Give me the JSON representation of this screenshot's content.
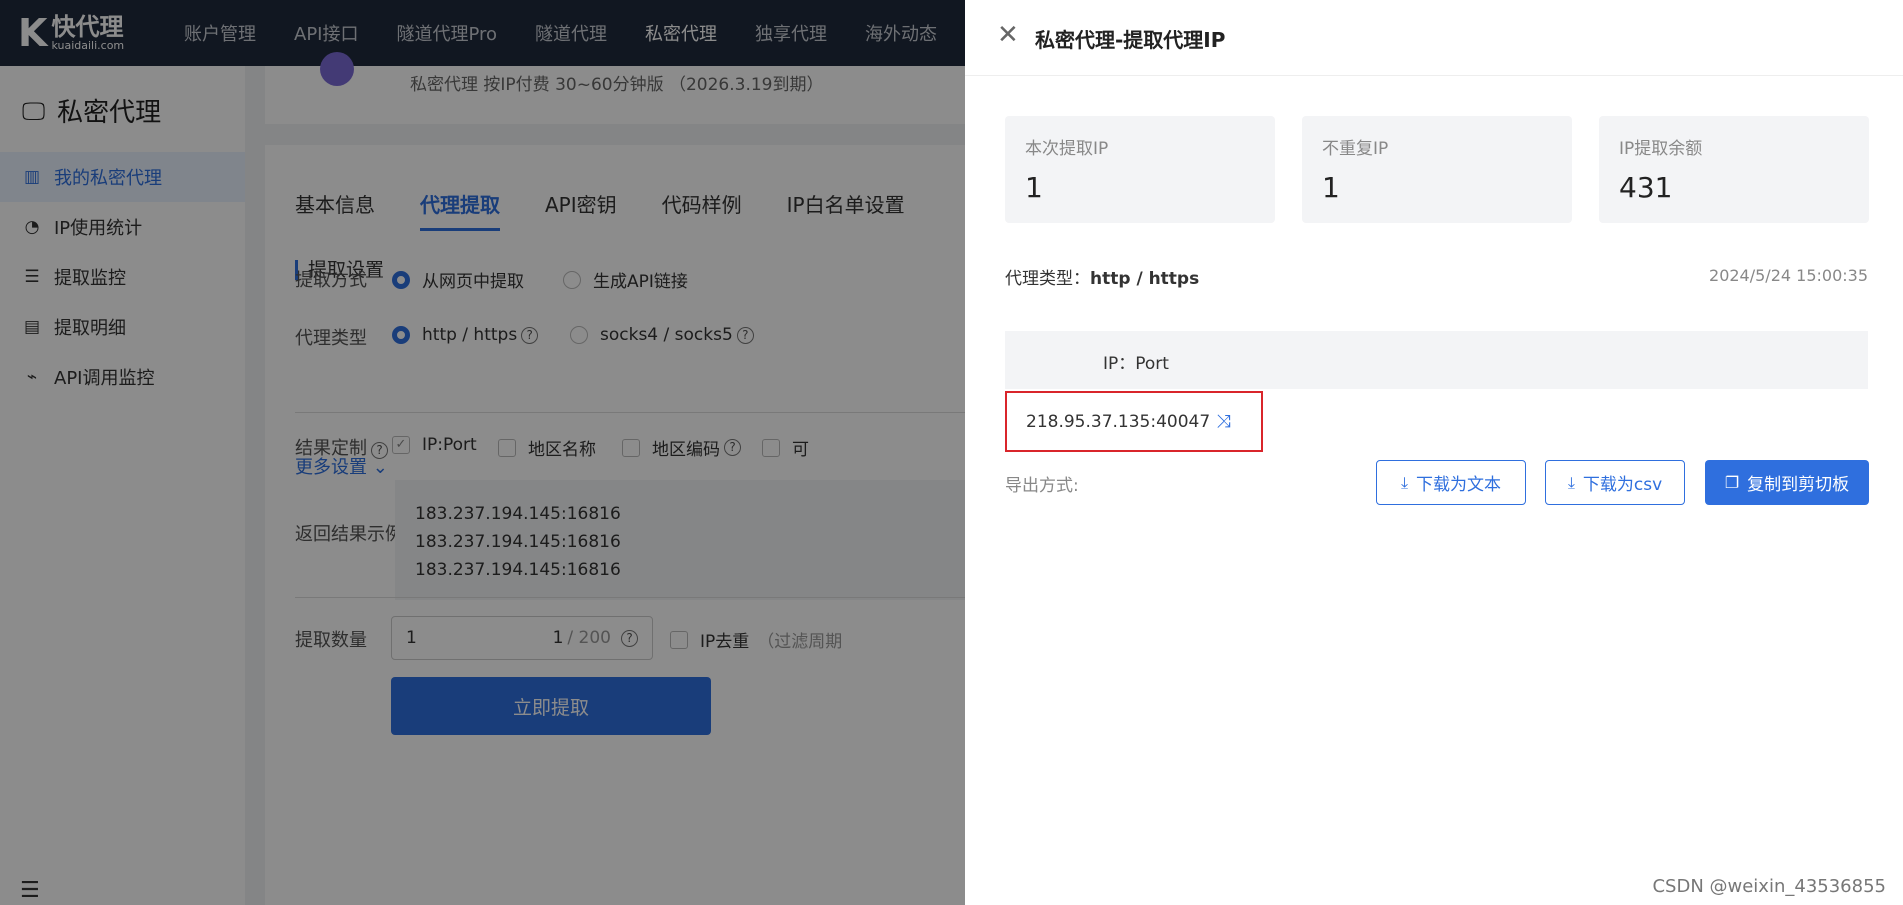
{
  "logo": {
    "mark": "K",
    "name": "快代理",
    "domain": "kuaidaili.com"
  },
  "topnav": [
    {
      "label": "账户管理"
    },
    {
      "label": "API接口"
    },
    {
      "label": "隧道代理Pro"
    },
    {
      "label": "隧道代理"
    },
    {
      "label": "私密代理",
      "active": true
    },
    {
      "label": "独享代理"
    },
    {
      "label": "海外动态"
    }
  ],
  "sidebar": {
    "title": "私密代理",
    "items": [
      {
        "label": "我的私密代理",
        "icon": "bar-chart-icon",
        "active": true
      },
      {
        "label": "IP使用统计",
        "icon": "pie-chart-icon"
      },
      {
        "label": "提取监控",
        "icon": "filter-icon"
      },
      {
        "label": "提取明细",
        "icon": "list-icon"
      },
      {
        "label": "API调用监控",
        "icon": "plug-icon"
      }
    ]
  },
  "main": {
    "subtitle": "私密代理  按IP付费  30~60分钟版  （2026.3.19到期）",
    "tabs": [
      "基本信息",
      "代理提取",
      "API密钥",
      "代码样例",
      "IP白名单设置"
    ],
    "active_tab": "代理提取",
    "section_title": "提取设置",
    "extract_method_label": "提取方式",
    "extract_methods": [
      "从网页中提取",
      "生成API链接"
    ],
    "proxy_type_label": "代理类型",
    "proxy_types": [
      "http / https",
      "socks4 / socks5"
    ],
    "more_settings": "更多设置",
    "result_label": "结果定制",
    "result_options": [
      "IP:Port",
      "地区名称",
      "地区编码",
      "可"
    ],
    "example_label": "返回结果示例",
    "example_lines": [
      "183.237.194.145:16816",
      "183.237.194.145:16816",
      "183.237.194.145:16816"
    ],
    "qty_label": "提取数量",
    "qty_value": "1",
    "qty_count": "1",
    "qty_max": "/ 200",
    "dedup_label": "IP去重",
    "dedup_note": "（过滤周期",
    "extract_button": "立即提取"
  },
  "drawer": {
    "title": "私密代理-提取代理IP",
    "stats": [
      {
        "label": "本次提取IP",
        "value": "1"
      },
      {
        "label": "不重复IP",
        "value": "1"
      },
      {
        "label": "IP提取余额",
        "value": "431"
      }
    ],
    "proxy_type_label": "代理类型：",
    "proxy_type_value": "http / https",
    "timestamp": "2024/5/24 15:00:35",
    "table_header": "IP：Port",
    "ip": "218.95.37.135:40047",
    "export_label": "导出方式:",
    "buttons": {
      "download_txt": "下载为文本",
      "download_csv": "下载为csv",
      "copy": "复制到剪切板"
    }
  },
  "watermark": "CSDN @weixin_43536855",
  "colors": {
    "primary": "#2f6fde",
    "highlight_border": "#d9252b",
    "nav_bg": "#1f2a3c"
  }
}
